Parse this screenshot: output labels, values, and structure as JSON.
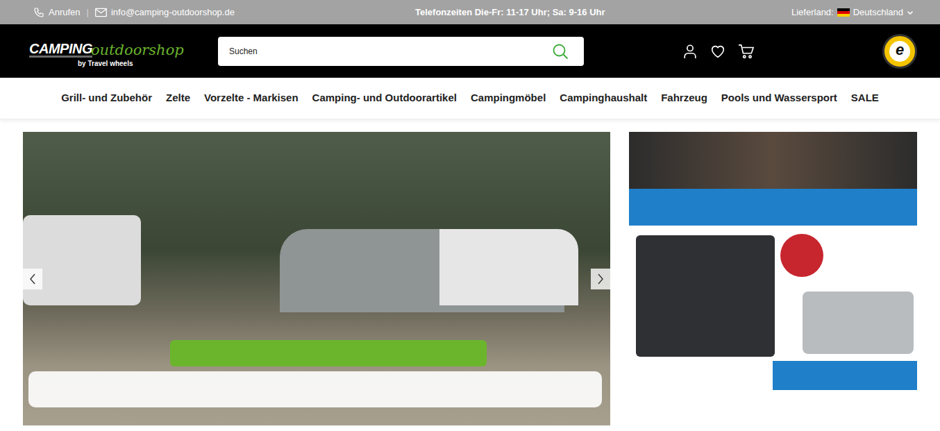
{
  "topbar": {
    "call": "Anrufen",
    "separator": "|",
    "email": "info@camping-outdoorshop.de",
    "hours": "Telefonzeiten Die-Fr: 11-17 Uhr; Sa: 9-16 Uhr",
    "country_label": "Lieferland:",
    "country": "Deutschland"
  },
  "logo": {
    "line1": "CAMPING",
    "line2": "outdoorshop",
    "line3": "by Travel wheels"
  },
  "search": {
    "placeholder": "Suchen"
  },
  "badge": {
    "letter": "e"
  },
  "nav": [
    {
      "label": "Grill- und Zubehör"
    },
    {
      "label": "Zelte"
    },
    {
      "label": "Vorzelte - Markisen"
    },
    {
      "label": "Camping- und Outdoorartikel"
    },
    {
      "label": "Campingmöbel"
    },
    {
      "label": "Campinghaushalt"
    },
    {
      "label": "Fahrzeug"
    },
    {
      "label": "Pools und Wassersport"
    },
    {
      "label": "SALE"
    }
  ]
}
